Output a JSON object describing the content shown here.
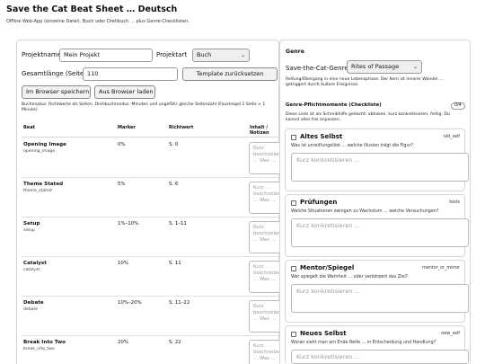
{
  "header": {
    "title": "Save the Cat Beat Sheet … Deutsch",
    "subtitle": "Offline Web-App (einzelne Datei). Buch oder Drehbuch … plus Genre-Checklisten."
  },
  "form": {
    "project_name_label": "Projektname",
    "project_name_value": "Mein Projekt",
    "project_type_label": "Projektart",
    "project_type_value": "Buch",
    "total_length_label": "Gesamtlänge (Seiten)",
    "total_length_value": "110",
    "reset_button": "Template zurücksetzen",
    "save_button": "Im Browser speichern",
    "load_button": "Aus Browser laden",
    "mode_note": "Buchmodus: Richtwerte als Seiten. Drehbuchmodus: Minuten und ungefähr gleiche Seitenzahl (Faustregel 1 Seite ≈ 1 Minute)."
  },
  "table": {
    "headers": [
      "Beat",
      "Marker",
      "Richtwert",
      "Inhalt / Notizen"
    ],
    "notes_placeholder": "Kurz beschreiben … Was …",
    "rows": [
      {
        "name": "Opening Image",
        "id": "opening_image",
        "marker": "0%",
        "target": "S. 0"
      },
      {
        "name": "Theme Stated",
        "id": "theme_stated",
        "marker": "5%",
        "target": "S. 6"
      },
      {
        "name": "Setup",
        "id": "setup",
        "marker": "1%–10%",
        "target": "S. 1–11"
      },
      {
        "name": "Catalyst",
        "id": "catalyst",
        "marker": "10%",
        "target": "S. 11"
      },
      {
        "name": "Debate",
        "id": "debate",
        "marker": "10%–20%",
        "target": "S. 11–22"
      },
      {
        "name": "Break Into Two",
        "id": "break_into_two",
        "marker": "20%",
        "target": "S. 22"
      }
    ]
  },
  "genre": {
    "section_title": "Genre",
    "genre_label": "Save-the-Cat-Genre",
    "genre_value": "Rites of Passage",
    "genre_desc": "Reifung/Übergang in eine neue Lebensphase. Der Kern ist innerer Wandel … getriggert durch äußere Ereignisse.",
    "checklist_title": "Genre-Pflichtmomente (Checkliste)",
    "checklist_count": "0/4",
    "checklist_desc": "Diese Liste ist als Schreibhilfe gedacht: abhaken, kurz konkretisieren, fertig. Du kannst alles frei anpassen.",
    "textarea_placeholder": "Kurz konkretisieren …",
    "items": [
      {
        "title": "Altes Selbst",
        "key": "old_self",
        "question": "Was ist unreif/ungelöst … welche Illusion trägt die Figur?"
      },
      {
        "title": "Prüfungen",
        "key": "tests",
        "question": "Welche Situationen zwingen zu Wachstum … welche Versuchungen?"
      },
      {
        "title": "Mentor/Spiegel",
        "key": "mentor_or_mirror",
        "question": "Wer spiegelt die Wahrheit … oder verkörpert das Ziel?"
      },
      {
        "title": "Neues Selbst",
        "key": "new_self",
        "question": "Woran sieht man am Ende Reife … in Entscheidung und Handlung?"
      }
    ]
  }
}
